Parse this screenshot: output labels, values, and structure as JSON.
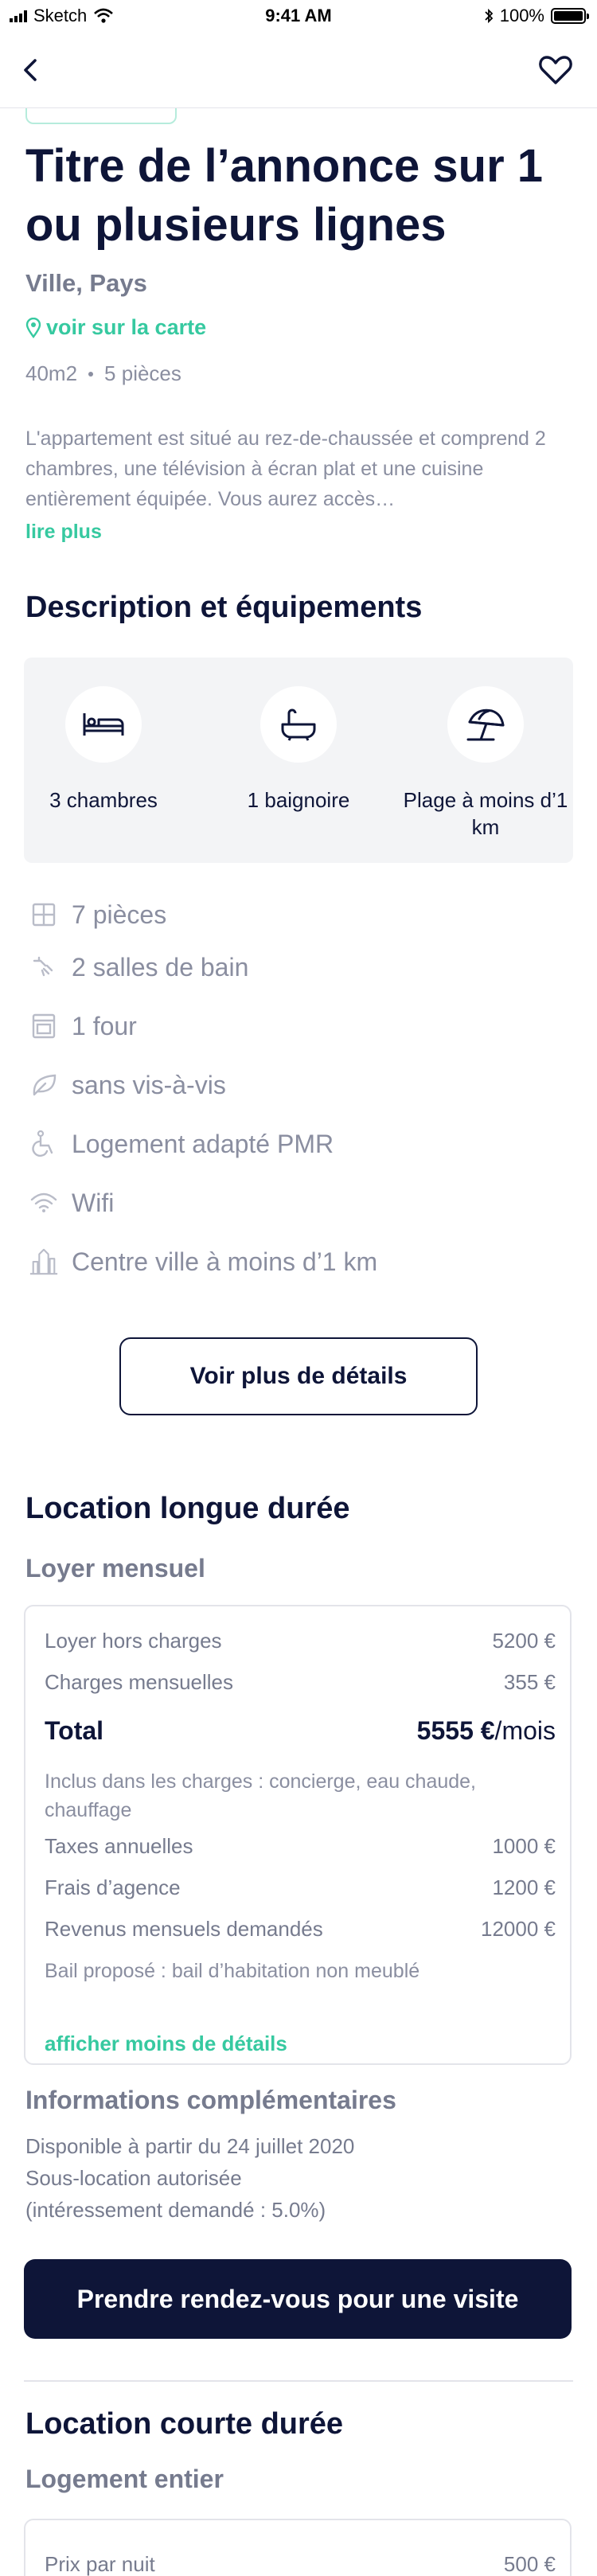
{
  "status_bar": {
    "carrier": "Sketch",
    "time": "9:41 AM",
    "battery": "100%"
  },
  "listing": {
    "title": "Titre de l’annonce sur 1 ou plusieurs lignes",
    "city": "Ville, Pays",
    "map_link": "voir sur la carte",
    "surface": "40m2",
    "rooms": "5 pièces",
    "description": "L'appartement est situé au rez-de-chaussée et comprend 2 chambres, une télévision à écran plat et une cuisine entièrement équipée. Vous aurez accès…",
    "read_more": "lire plus"
  },
  "equipment": {
    "heading": "Description et équipements",
    "highlights": [
      {
        "label": "3 chambres",
        "icon": "bed-icon"
      },
      {
        "label": "1 baignoire",
        "icon": "bathtub-icon"
      },
      {
        "label": "Plage à moins d’1 km",
        "icon": "beach-umbrella-icon"
      }
    ],
    "amenities": [
      {
        "label": "7 pièces",
        "icon": "rooms-icon"
      },
      {
        "label": "2 salles de bain",
        "icon": "shower-icon"
      },
      {
        "label": "1 four",
        "icon": "oven-icon"
      },
      {
        "label": "sans vis-à-vis",
        "icon": "leaf-icon"
      },
      {
        "label": "Logement adapté PMR",
        "icon": "wheelchair-icon"
      },
      {
        "label": "Wifi",
        "icon": "wifi-icon"
      },
      {
        "label": "Centre ville à moins d’1 km",
        "icon": "city-icon"
      }
    ],
    "more_button": "Voir plus de détails"
  },
  "long_term": {
    "heading": "Location longue durée",
    "subheading": "Loyer mensuel",
    "rows": {
      "rent": {
        "label": "Loyer hors charges",
        "value": "5200 €"
      },
      "charges": {
        "label": "Charges mensuelles",
        "value": "355 €"
      },
      "total": {
        "label": "Total",
        "value": "5555 €",
        "unit": "/mois"
      },
      "included": "Inclus dans les charges : concierge, eau chaude, chauffage",
      "taxes": {
        "label": "Taxes annuelles",
        "value": "1000 €"
      },
      "agency": {
        "label": "Frais d’agence",
        "value": "1200 €"
      },
      "income": {
        "label": "Revenus mensuels demandés",
        "value": "12000 €"
      },
      "lease": "Bail proposé : bail d’habitation non meublé"
    },
    "less_details": "afficher moins de détails",
    "info_heading": "Informations complémentaires",
    "info_lines": [
      "Disponible à partir du 24 juillet 2020",
      "Sous-location autorisée",
      "(intéressement demandé : 5.0%)"
    ],
    "cta": "Prendre rendez-vous pour une visite"
  },
  "short_term": {
    "heading": "Location courte durée",
    "subheading": "Logement entier",
    "night_price": {
      "label": "Prix par nuit",
      "value": "500 €"
    }
  },
  "colors": {
    "navy": "#0e1538",
    "accent": "#36c9a0",
    "muted": "#8a8ea0"
  }
}
